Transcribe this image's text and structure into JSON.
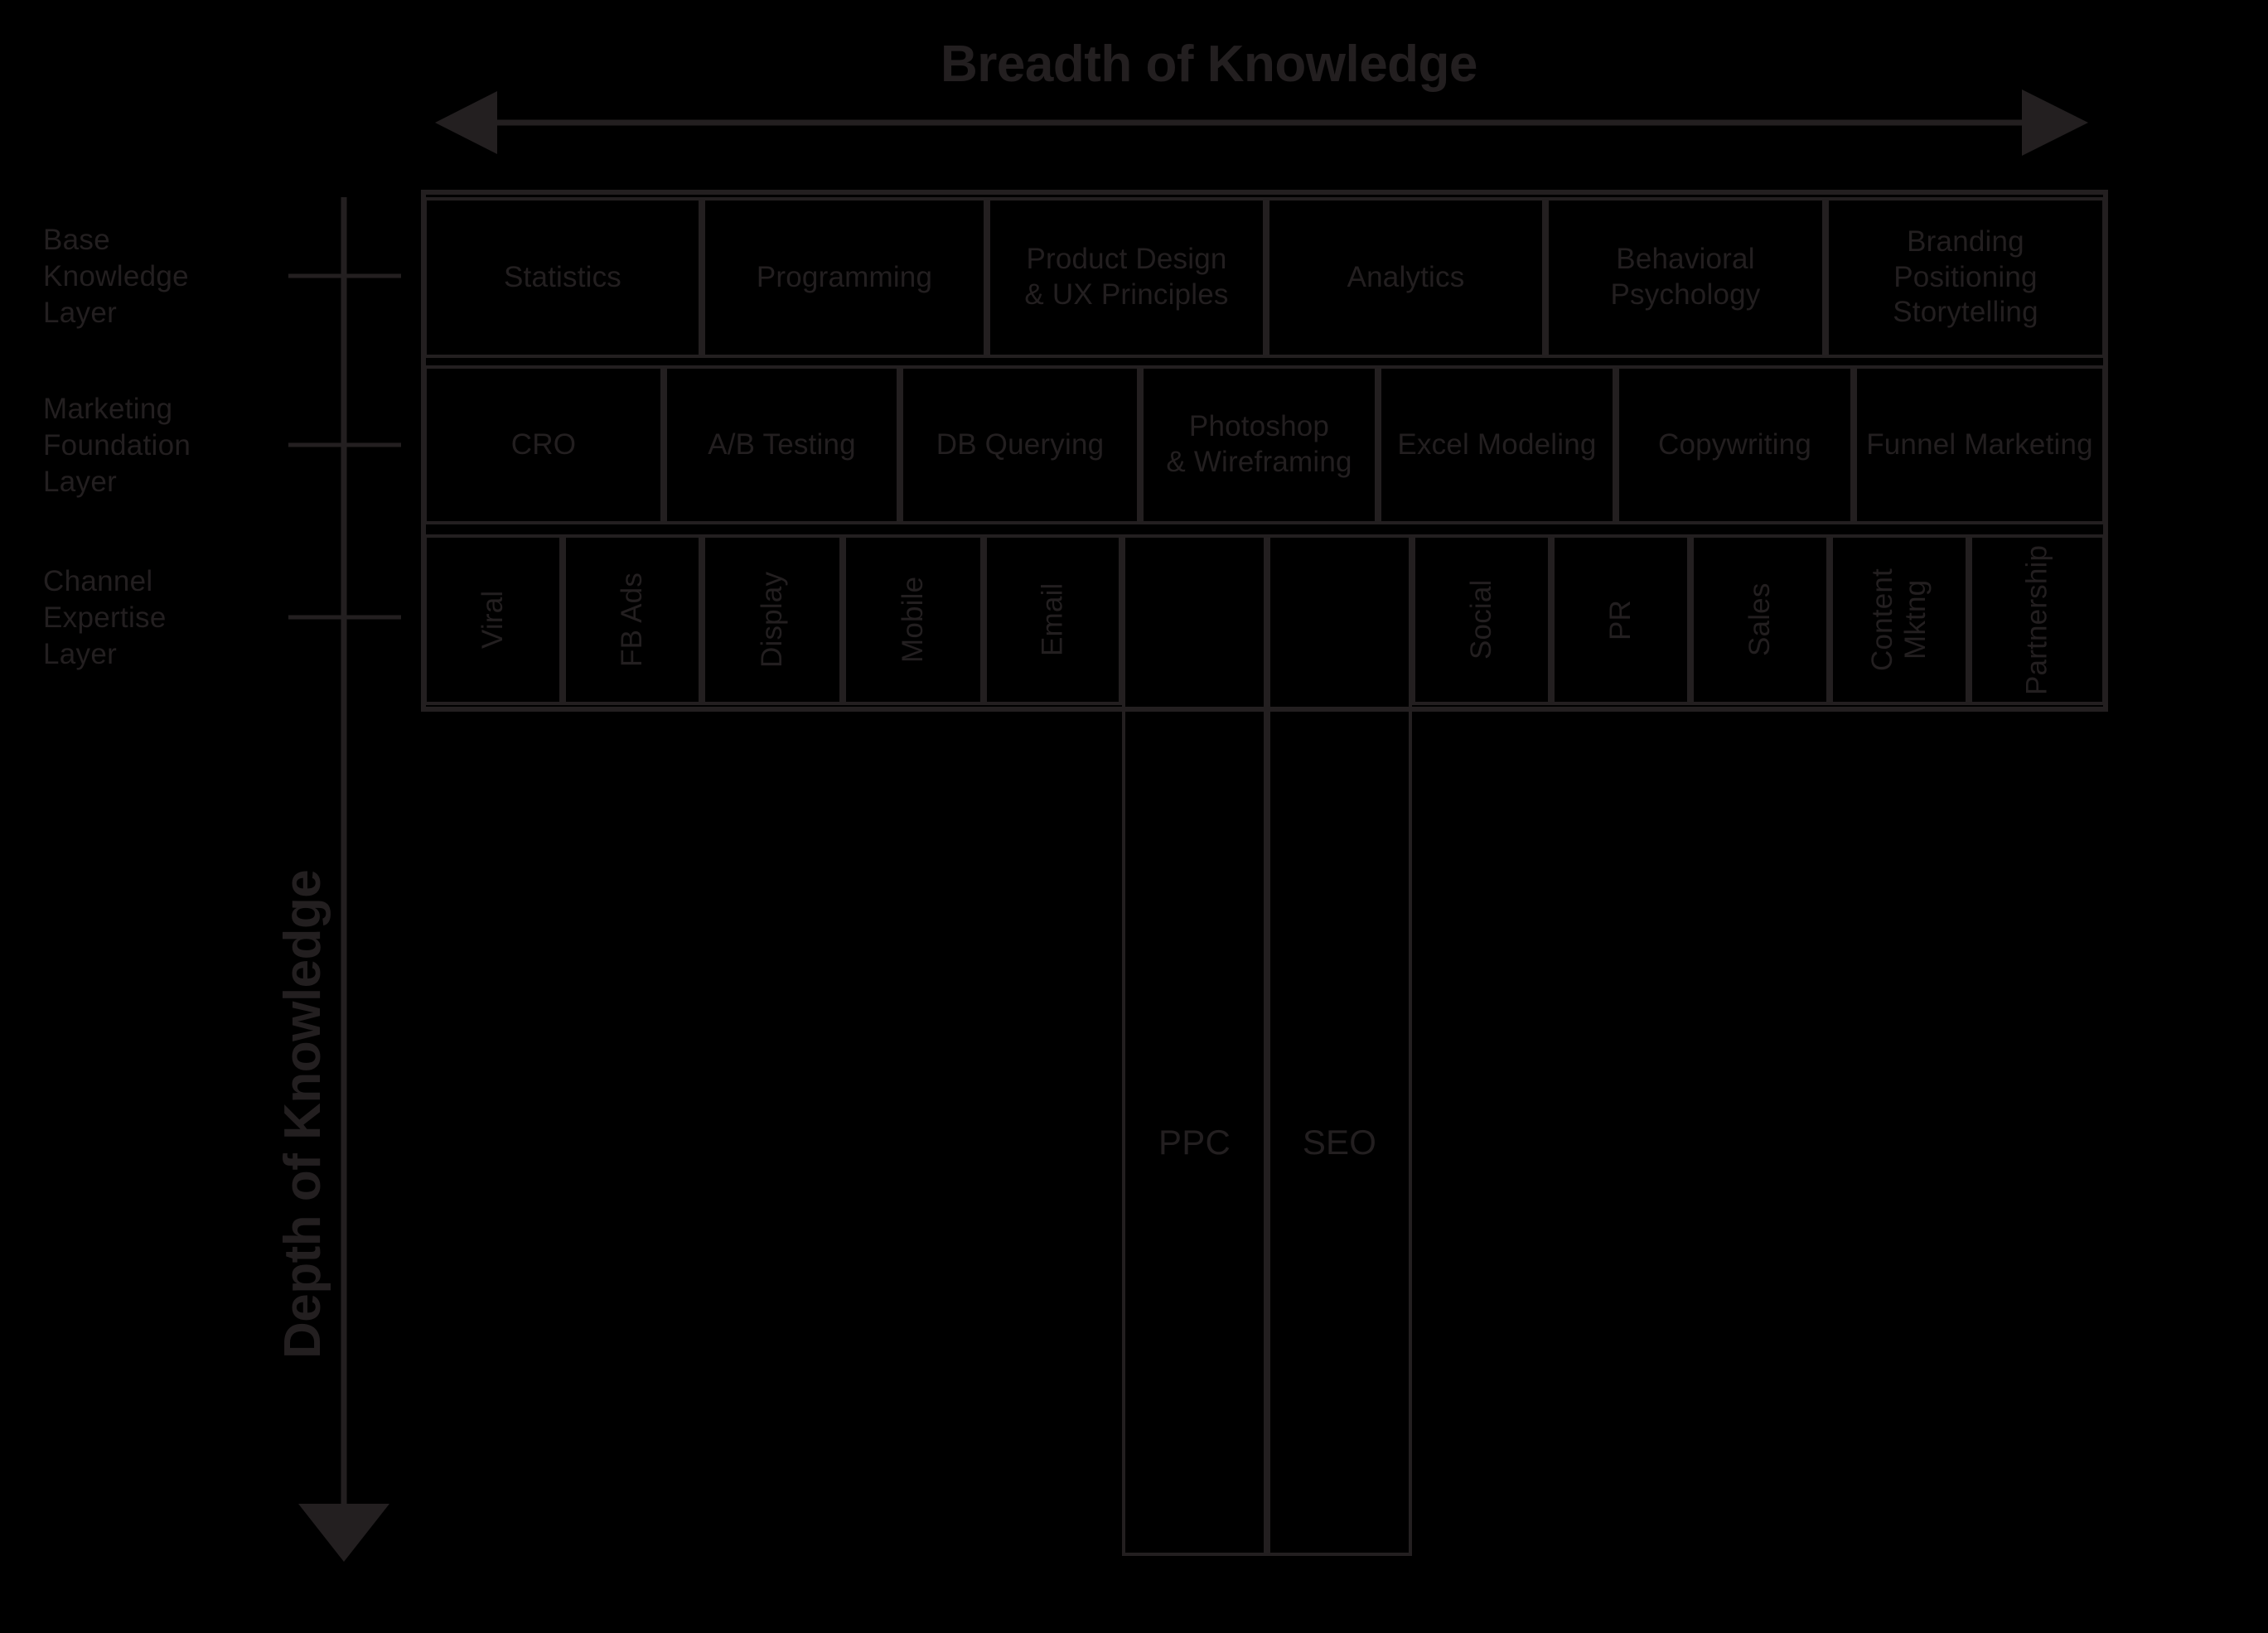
{
  "colors": {
    "ink": "#231f20",
    "background": "#000000"
  },
  "axes": {
    "horizontal": {
      "title": "Breadth of Knowledge",
      "arrow": "double-headed-horizontal-arrow"
    },
    "vertical": {
      "title": "Depth of Knowledge",
      "arrow": "down-arrow"
    }
  },
  "layers": [
    {
      "key": "base",
      "label": "Base\nKnowledge\nLayer"
    },
    {
      "key": "marketing",
      "label": "Marketing\nFoundation\nLayer"
    },
    {
      "key": "channel",
      "label": "Channel\nExpertise\nLayer"
    }
  ],
  "rows": {
    "base_knowledge": [
      {
        "label": "Statistics"
      },
      {
        "label": "Programming"
      },
      {
        "label": "Product Design\n& UX Principles"
      },
      {
        "label": "Analytics"
      },
      {
        "label": "Behavioral\nPsychology"
      },
      {
        "label": "Branding\nPositioning\nStorytelling"
      }
    ],
    "marketing_foundation": [
      {
        "label": "CRO"
      },
      {
        "label": "A/B Testing"
      },
      {
        "label": "DB Querying"
      },
      {
        "label": "Photoshop\n& Wireframing"
      },
      {
        "label": "Excel Modeling"
      },
      {
        "label": "Copywriting"
      },
      {
        "label": "Funnel Marketing"
      }
    ],
    "channel_expertise": [
      {
        "label": "Viral",
        "orientation": "vertical"
      },
      {
        "label": "FB Ads",
        "orientation": "vertical"
      },
      {
        "label": "Display",
        "orientation": "vertical"
      },
      {
        "label": "Mobile",
        "orientation": "vertical"
      },
      {
        "label": "Email",
        "orientation": "vertical"
      },
      {
        "label": "PPC",
        "orientation": "horizontal",
        "deep": true
      },
      {
        "label": "SEO",
        "orientation": "horizontal",
        "deep": true
      },
      {
        "label": "Social",
        "orientation": "vertical"
      },
      {
        "label": "PR",
        "orientation": "vertical"
      },
      {
        "label": "Sales",
        "orientation": "vertical"
      },
      {
        "label": "Content\nMktng",
        "orientation": "vertical"
      },
      {
        "label": "Partnership",
        "orientation": "vertical"
      }
    ]
  }
}
